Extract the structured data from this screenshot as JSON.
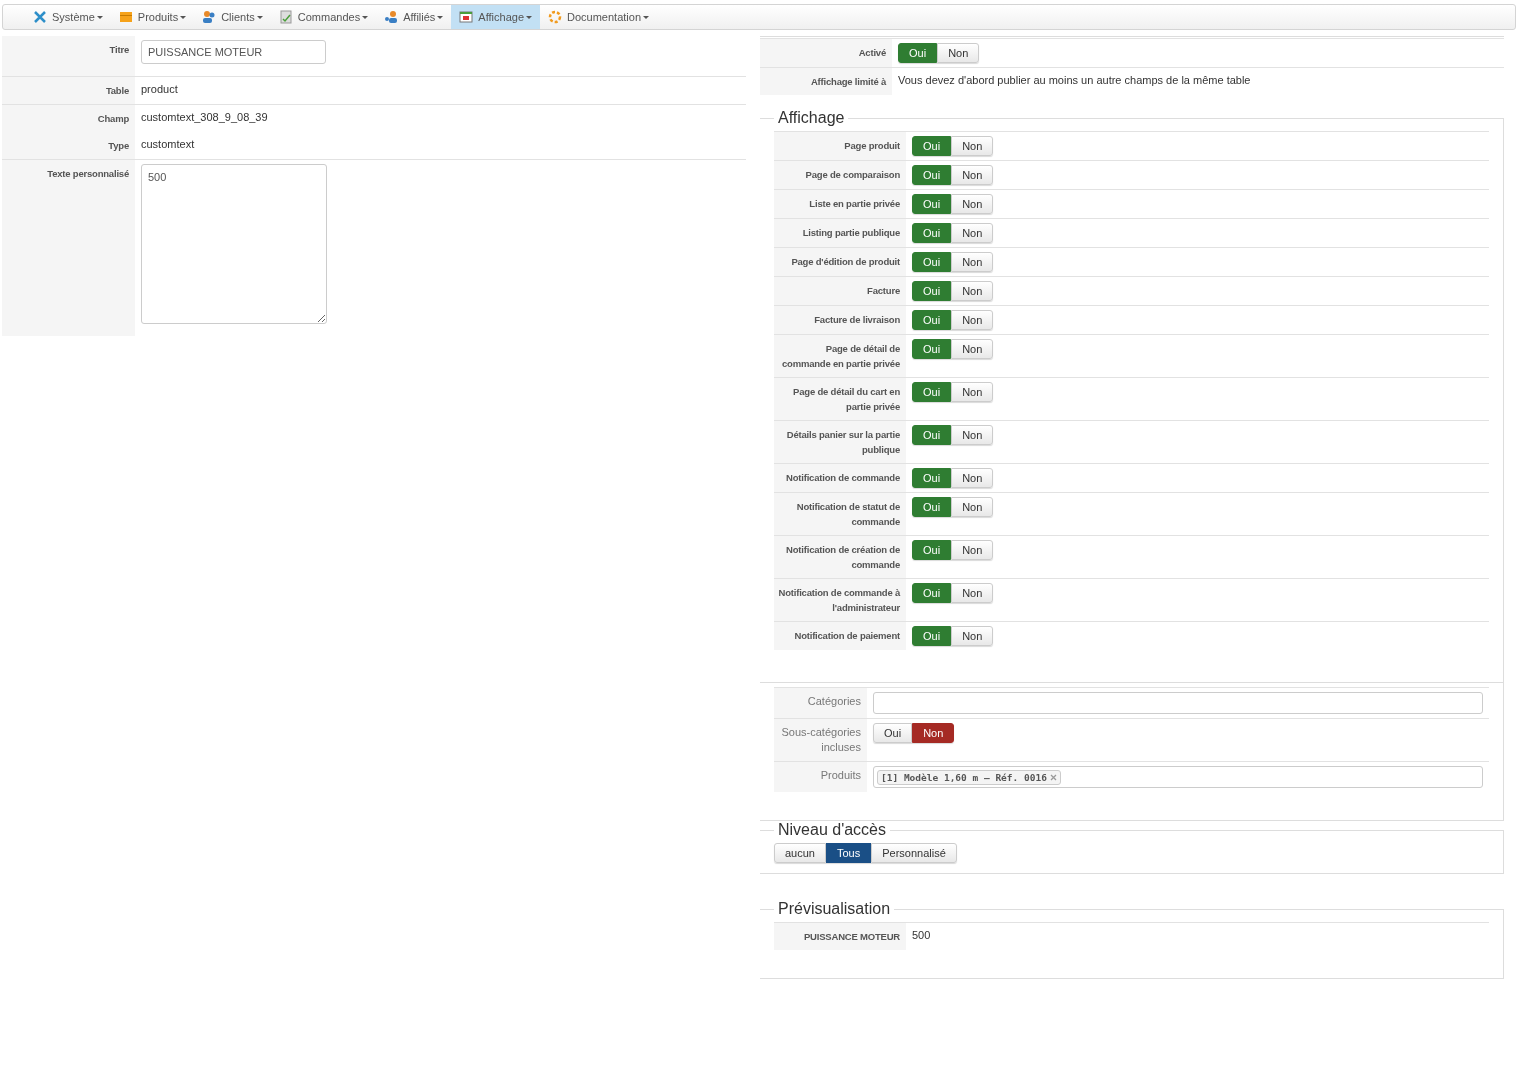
{
  "menu": [
    {
      "label": "Système",
      "selected": false
    },
    {
      "label": "Produits",
      "selected": false
    },
    {
      "label": "Clients",
      "selected": false
    },
    {
      "label": "Commandes",
      "selected": false
    },
    {
      "label": "Affiliés",
      "selected": false
    },
    {
      "label": "Affichage",
      "selected": true
    },
    {
      "label": "Documentation",
      "selected": false
    }
  ],
  "field_details": [
    {
      "label": "Titre",
      "kind": "input",
      "value": "PUISSANCE MOTEUR"
    },
    {
      "label": "Table",
      "kind": "text",
      "value": "product"
    },
    {
      "label": "Champ",
      "kind": "text",
      "value": "customtext_308_9_08_39"
    },
    {
      "label": "Type",
      "kind": "text",
      "value": "customtext"
    },
    {
      "label": "Texte personnalisé",
      "kind": "textarea",
      "value": "500"
    }
  ],
  "status": [
    {
      "label": "Activé",
      "kind": "toggle",
      "options": [
        {
          "label": "Oui",
          "selected": true
        },
        {
          "label": "Non",
          "selected": false
        }
      ]
    },
    {
      "label": "Affichage limité à",
      "kind": "text",
      "value": "Vous devez d'abord publier au moins un autre champs de la même table"
    }
  ],
  "affichage": {
    "legend": "Affichage",
    "rows": [
      {
        "label": "Page produit",
        "options": [
          {
            "label": "Oui",
            "selected": true
          },
          {
            "label": "Non",
            "selected": false
          }
        ]
      },
      {
        "label": "Page de comparaison",
        "options": [
          {
            "label": "Oui",
            "selected": true
          },
          {
            "label": "Non",
            "selected": false
          }
        ]
      },
      {
        "label": "Liste en partie privée",
        "options": [
          {
            "label": "Oui",
            "selected": true
          },
          {
            "label": "Non",
            "selected": false
          }
        ]
      },
      {
        "label": "Listing partie publique",
        "options": [
          {
            "label": "Oui",
            "selected": true
          },
          {
            "label": "Non",
            "selected": false
          }
        ]
      },
      {
        "label": "Page d'édition de produit",
        "options": [
          {
            "label": "Oui",
            "selected": true
          },
          {
            "label": "Non",
            "selected": false
          }
        ]
      },
      {
        "label": "Facture",
        "options": [
          {
            "label": "Oui",
            "selected": true
          },
          {
            "label": "Non",
            "selected": false
          }
        ]
      },
      {
        "label": "Facture de livraison",
        "options": [
          {
            "label": "Oui",
            "selected": true
          },
          {
            "label": "Non",
            "selected": false
          }
        ]
      },
      {
        "label": "Page de détail de commande en partie privée",
        "options": [
          {
            "label": "Oui",
            "selected": true
          },
          {
            "label": "Non",
            "selected": false
          }
        ]
      },
      {
        "label": "Page de détail du cart en partie privée",
        "options": [
          {
            "label": "Oui",
            "selected": true
          },
          {
            "label": "Non",
            "selected": false
          }
        ]
      },
      {
        "label": "Détails panier sur la partie publique",
        "options": [
          {
            "label": "Oui",
            "selected": true
          },
          {
            "label": "Non",
            "selected": false
          }
        ]
      },
      {
        "label": "Notification de commande",
        "options": [
          {
            "label": "Oui",
            "selected": true
          },
          {
            "label": "Non",
            "selected": false
          }
        ]
      },
      {
        "label": "Notification de statut de commande",
        "options": [
          {
            "label": "Oui",
            "selected": true
          },
          {
            "label": "Non",
            "selected": false
          }
        ]
      },
      {
        "label": "Notification de création de commande",
        "options": [
          {
            "label": "Oui",
            "selected": true
          },
          {
            "label": "Non",
            "selected": false
          }
        ]
      },
      {
        "label": "Notification de commande à l'administrateur",
        "options": [
          {
            "label": "Oui",
            "selected": true
          },
          {
            "label": "Non",
            "selected": false
          }
        ]
      },
      {
        "label": "Notification de paiement",
        "options": [
          {
            "label": "Oui",
            "selected": true
          },
          {
            "label": "Non",
            "selected": false
          }
        ]
      }
    ]
  },
  "filters": [
    {
      "label": "Catégories",
      "kind": "input"
    },
    {
      "label": "Sous-catégories incluses",
      "kind": "toggle",
      "options": [
        {
          "label": "Oui",
          "selected": false
        },
        {
          "label": "Non",
          "selected": true
        }
      ]
    },
    {
      "label": "Produits",
      "kind": "tags",
      "tags": [
        "[1] Modèle 1,60 m – Réf. 0016"
      ]
    }
  ],
  "access": {
    "legend": "Niveau d'accès",
    "options": [
      {
        "label": "aucun",
        "selected": false
      },
      {
        "label": "Tous",
        "selected": true
      },
      {
        "label": "Personnalisé",
        "selected": false
      }
    ]
  },
  "preview": {
    "legend": "Prévisualisation",
    "label": "PUISSANCE MOTEUR",
    "value": "500"
  }
}
